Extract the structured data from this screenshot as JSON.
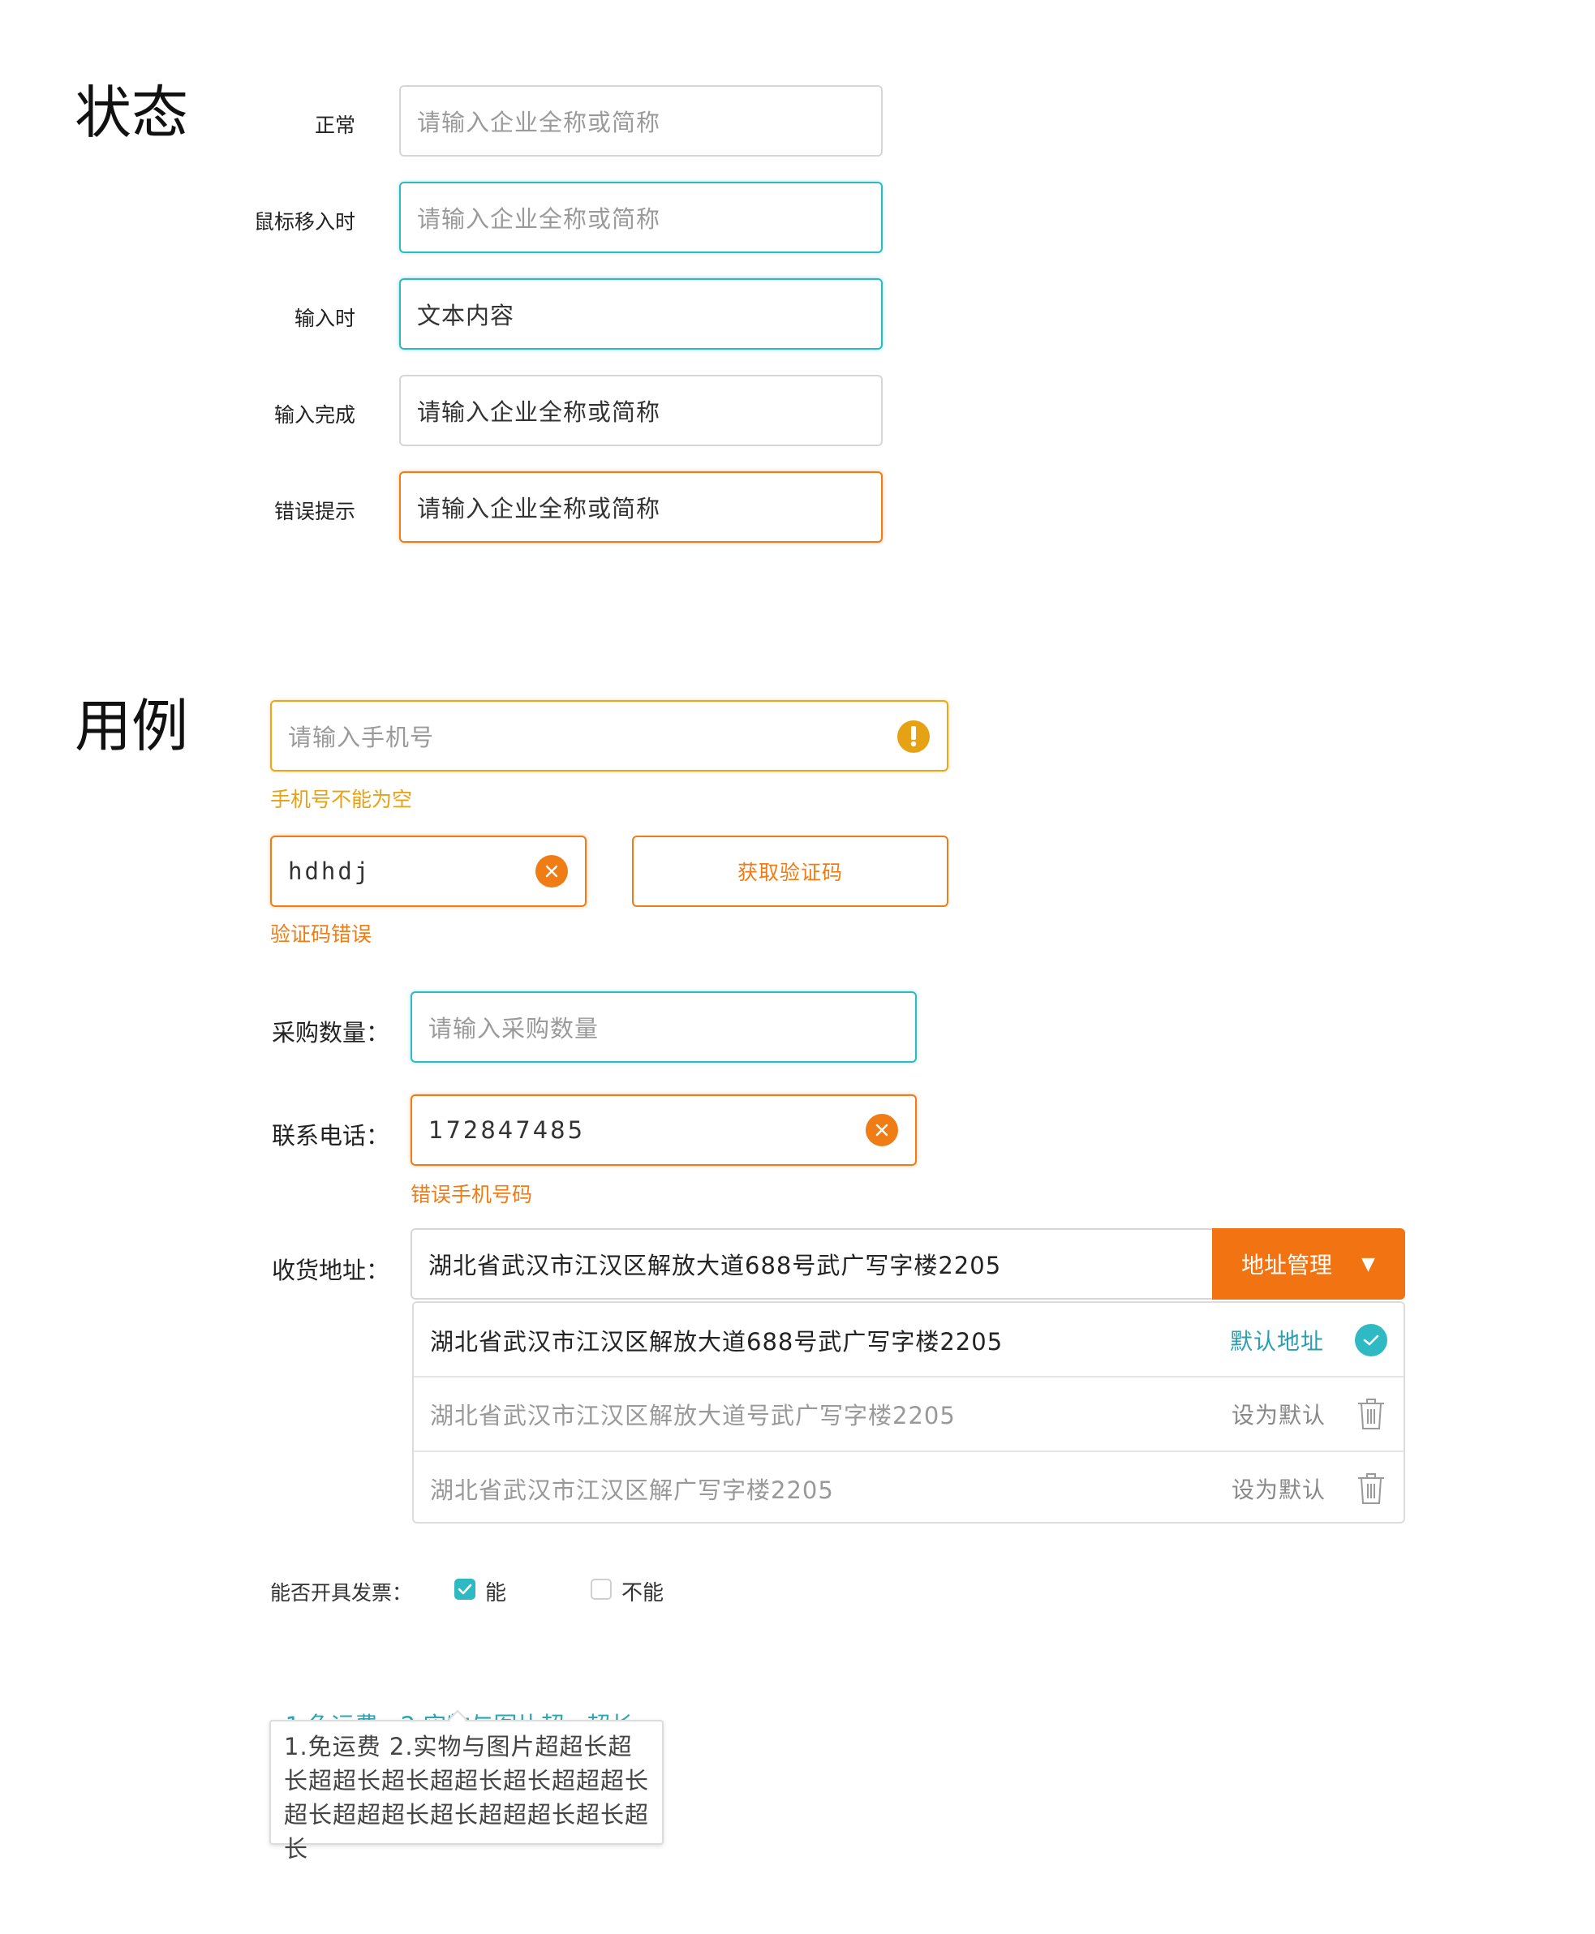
{
  "sections": {
    "states_title": "状态",
    "examples_title": "用例"
  },
  "states": [
    {
      "label": "正常",
      "text": "请输入企业全称或简称",
      "kind": "placeholder"
    },
    {
      "label": "鼠标移入时",
      "text": "请输入企业全称或简称",
      "kind": "placeholder"
    },
    {
      "label": "输入时",
      "text": "文本内容",
      "kind": "value"
    },
    {
      "label": "输入完成",
      "text": "请输入企业全称或简称",
      "kind": "value"
    },
    {
      "label": "错误提示",
      "text": "请输入企业全称或简称",
      "kind": "value"
    }
  ],
  "phone": {
    "placeholder": "请输入手机号",
    "warning": "手机号不能为空",
    "warn_icon": "exclamation-icon"
  },
  "code": {
    "value": "hdhdj",
    "button": "获取验证码",
    "error": "验证码错误",
    "clear_icon": "clear-icon"
  },
  "quantity": {
    "label": "采购数量：",
    "placeholder": "请输入采购数量"
  },
  "contact": {
    "label": "联系电话：",
    "value": "172847485",
    "error": "错误手机号码"
  },
  "address": {
    "label": "收货地址：",
    "value": "湖北省武汉市江汉区解放大道688号武广写字楼2205",
    "manage_button": "地址管理",
    "arrow": "▼",
    "items": [
      {
        "text": "湖北省武汉市江汉区解放大道688号武广写字楼2205",
        "action": "默认地址",
        "icon": "check-circle-icon"
      },
      {
        "text": "湖北省武汉市江汉区解放大道号武广写字楼2205",
        "action": "设为默认",
        "icon": "trash-icon"
      },
      {
        "text": "湖北省武汉市江汉区解广写字楼2205",
        "action": "设为默认",
        "icon": "trash-icon"
      }
    ]
  },
  "invoice": {
    "label": "能否开具发票：",
    "yes": "能",
    "no": "不能",
    "yes_checked": true,
    "no_checked": false
  },
  "tooltip": {
    "link": "1.免运费   2.实物与图片超···超长",
    "chevron": "›",
    "content": "1.免运费   2.实物与图片超超长超长超超长超长超超长超长超超超长超长超超超长超长超超超长超长超长"
  },
  "colors": {
    "teal": "#2fb9c2",
    "orange": "#f07c15",
    "warn": "#e6a214",
    "manage_bg": "#f27312"
  }
}
